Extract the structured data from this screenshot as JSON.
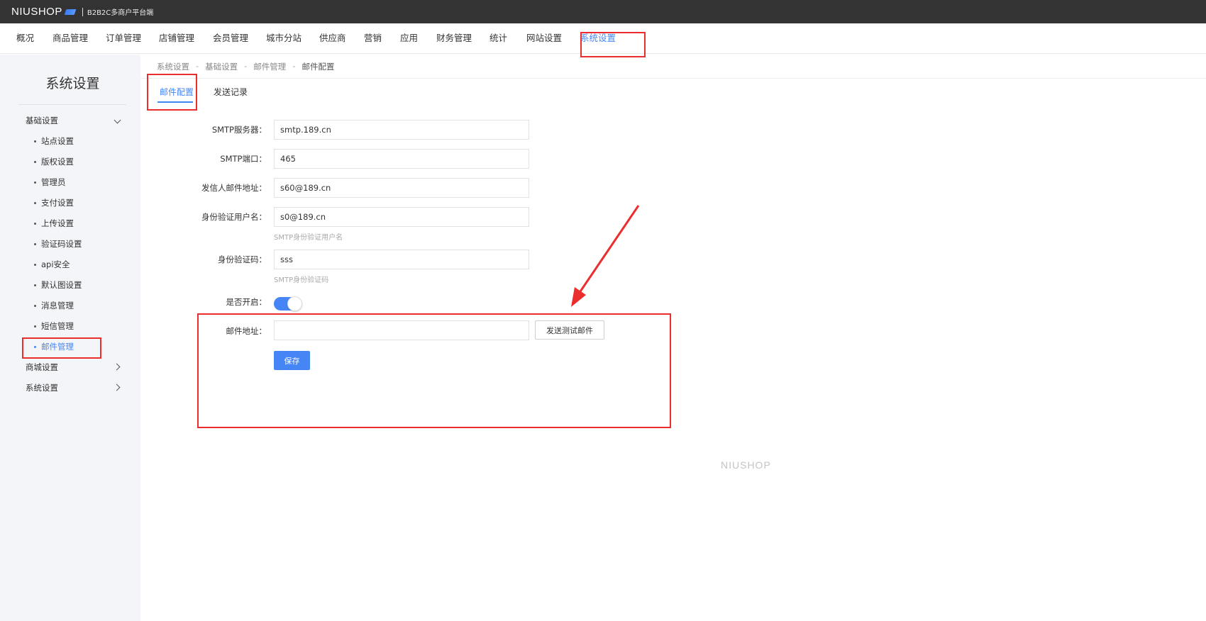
{
  "header": {
    "logo_text": "NIUSHOP",
    "platform": "B2B2C多商户平台端"
  },
  "mainnav": {
    "items": [
      "概况",
      "商品管理",
      "订单管理",
      "店铺管理",
      "会员管理",
      "城市分站",
      "供应商",
      "营销",
      "应用",
      "财务管理",
      "统计",
      "网站设置",
      "系统设置"
    ],
    "active": "系统设置"
  },
  "sidebar": {
    "title": "系统设置",
    "groups": [
      {
        "label": "基础设置",
        "expanded": true,
        "items": [
          "站点设置",
          "版权设置",
          "管理员",
          "支付设置",
          "上传设置",
          "验证码设置",
          "api安全",
          "默认图设置",
          "消息管理",
          "短信管理",
          "邮件管理"
        ],
        "active_item": "邮件管理"
      },
      {
        "label": "商城设置",
        "expanded": false
      },
      {
        "label": "系统设置",
        "expanded": false
      }
    ]
  },
  "breadcrumb": [
    "系统设置",
    "基础设置",
    "邮件管理",
    "邮件配置"
  ],
  "breadcrumb_separator": "-",
  "tabs": [
    "邮件配置",
    "发送记录"
  ],
  "active_tab": "邮件配置",
  "form": {
    "smtp_server": {
      "label": "SMTP服务器：",
      "value": "smtp.189.cn"
    },
    "smtp_port": {
      "label": "SMTP端口：",
      "value": "465"
    },
    "sender_email": {
      "label": "发信人邮件地址：",
      "value": "s60@189.cn"
    },
    "auth_username": {
      "label": "身份验证用户名：",
      "value": "s0@189.cn",
      "hint": "SMTP身份验证用户名"
    },
    "auth_password": {
      "label": "身份验证码：",
      "value": "sss",
      "hint": "SMTP身份验证码"
    },
    "enabled": {
      "label": "是否开启：",
      "on": true
    },
    "test_email": {
      "label": "邮件地址：",
      "value": "",
      "button": "发送测试邮件"
    },
    "save_button": "保存"
  },
  "footer_watermark": "NIUSHOP",
  "colors": {
    "accent": "#4685f5",
    "topbar": "#333333",
    "annotation": "#ec2d2d",
    "sidebar_bg": "#f4f5f8"
  }
}
